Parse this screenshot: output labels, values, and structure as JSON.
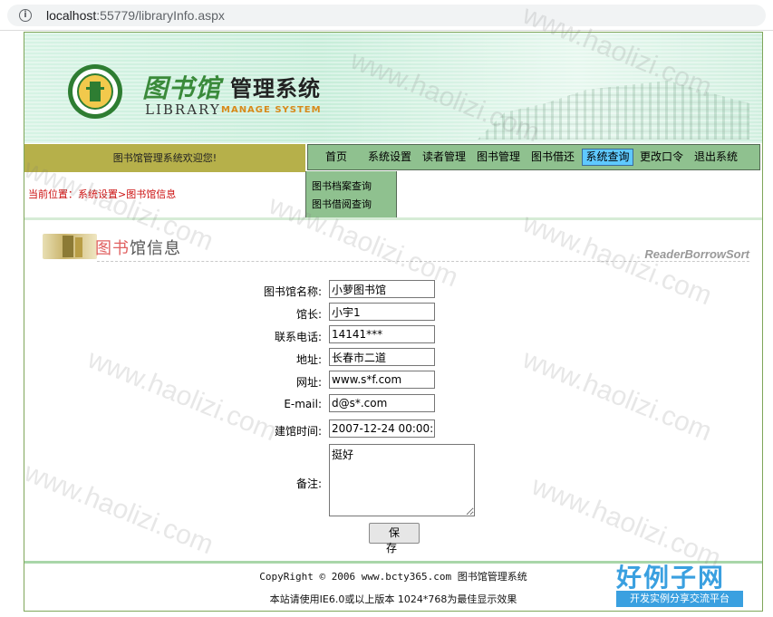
{
  "browser": {
    "url_host": "localhost",
    "url_rest": ":55779/libraryInfo.aspx"
  },
  "banner": {
    "logo_cn": "图书馆",
    "logo_cn2": "管理系统",
    "logo_en1": "LIBRARY",
    "logo_en2": "MANAGE SYSTEM"
  },
  "welcome": "图书馆管理系统欢迎您!",
  "nav": {
    "items": [
      "首页",
      "系统设置",
      "读者管理",
      "图书管理",
      "图书借还",
      "系统查询",
      "更改口令",
      "退出系统"
    ],
    "active": "系统查询"
  },
  "dropdown": [
    "图书档案查询",
    "图书借阅查询"
  ],
  "breadcrumb": "当前位置：系统设置>图书馆信息",
  "section": {
    "title_red": "图书",
    "title_gray": "馆信息",
    "en": "ReaderBorrowSort"
  },
  "form": {
    "name_label": "图书馆名称:",
    "name_value": "小萝图书馆",
    "curator_label": "馆长:",
    "curator_value": "小宇1",
    "phone_label": "联系电话:",
    "phone_value": "14141***",
    "address_label": "地址:",
    "address_value": "长春市二道",
    "site_label": "网址:",
    "site_value": "www.s*f.com",
    "email_label": "E-mail:",
    "email_value": "d@s*.com",
    "date_label": "建馆时间:",
    "date_value": "2007-12-24 00:00:0",
    "note_label": "备注:",
    "note_value": "挺好",
    "save_label": "保 存"
  },
  "footer": {
    "line1": "CopyRight © 2006 www.bcty365.com 图书馆管理系统",
    "line2": "本站请使用IE6.0或以上版本 1024*768为最佳显示效果"
  },
  "watermark": "www.haolizi.com",
  "brand": {
    "title": "好例子网",
    "sub": "开发实例分享交流平台"
  },
  "colors": {
    "nav_green": "#8fc18f",
    "welcome_olive": "#b6b04a",
    "active_blue": "#5fc9ff",
    "breadcrumb_red": "#cc1010"
  }
}
